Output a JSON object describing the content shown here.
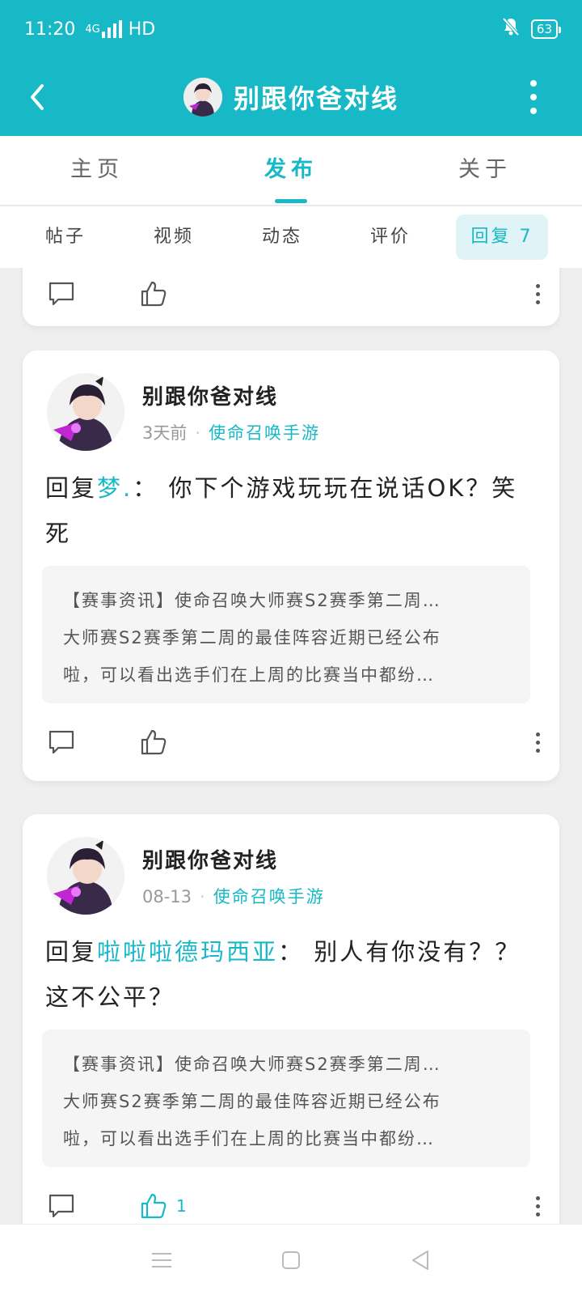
{
  "status_bar": {
    "time": "11:20",
    "network": "4G",
    "quality": "HD",
    "battery": "63"
  },
  "nav": {
    "title": "别跟你爸对线"
  },
  "main_tabs": [
    {
      "label": "主页",
      "active": false
    },
    {
      "label": "发布",
      "active": true
    },
    {
      "label": "关于",
      "active": false
    }
  ],
  "sub_tabs": [
    {
      "label": "帖子",
      "active": false
    },
    {
      "label": "视频",
      "active": false
    },
    {
      "label": "动态",
      "active": false
    },
    {
      "label": "评价",
      "active": false
    },
    {
      "label": "回复 7",
      "active": true
    }
  ],
  "posts": [
    {
      "user": "别跟你爸对线",
      "time": "3天前",
      "game": "使命召唤手游",
      "reply_prefix": "回复",
      "mention": "梦.",
      "reply_body": "： 你下个游戏玩玩在说话OK？笑死",
      "quote_lines": [
        "【赛事资讯】使命召唤大师赛S2赛季第二周…",
        "大师赛S2赛季第二周的最佳阵容近期已经公布",
        "啦，可以看出选手们在上周的比赛当中都纷…"
      ],
      "like_count": ""
    },
    {
      "user": "别跟你爸对线",
      "time": "08-13",
      "game": "使命召唤手游",
      "reply_prefix": "回复",
      "mention": "啦啦啦德玛西亚",
      "reply_body": "： 别人有你没有？？这不公平？",
      "quote_lines": [
        "【赛事资讯】使命召唤大师赛S2赛季第二周…",
        "大师赛S2赛季第二周的最佳阵容近期已经公布",
        "啦，可以看出选手们在上周的比赛当中都纷…"
      ],
      "like_count": "1"
    }
  ],
  "colors": {
    "accent": "#17b9c6",
    "background": "#efefef"
  },
  "icons": [
    "back-icon",
    "more-icon",
    "comment-icon",
    "like-icon",
    "kebab-icon",
    "menu-icon",
    "home-square-icon",
    "back-triangle-icon"
  ]
}
